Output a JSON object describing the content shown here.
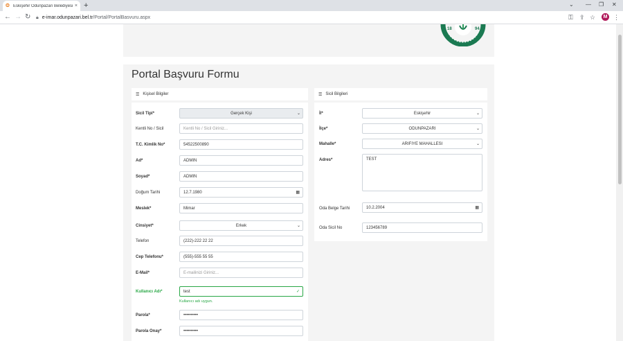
{
  "browser": {
    "tab_title": "Eskişehir Odunpazarı Belediyesi :: ...",
    "tab_close": "×",
    "new_tab": "+",
    "url_host": "e-imar.odunpazari.bel.tr",
    "url_path": "/Portal/PortalBasvuru.aspx",
    "avatar_letter": "M",
    "win_min": "—",
    "win_max": "❐",
    "win_close": "✕",
    "collapse": "⌄"
  },
  "page": {
    "title": "Portal Başvuru Formu"
  },
  "left_panel": {
    "heading": "Kişisel Bilgiler",
    "fields": [
      {
        "label": "Sicil Tipi*",
        "value": "Gerçek Kişi"
      },
      {
        "label": "Kentli No / Sicil",
        "placeholder": "Kentli No / Sicil Giriniz..."
      },
      {
        "label": "T.C. Kimlik No*",
        "value": "54522500890"
      },
      {
        "label": "Ad*",
        "value": "ADMIN"
      },
      {
        "label": "Soyad*",
        "value": "ADMIN"
      },
      {
        "label": "Doğum Tarihi",
        "value": "12.7.1980"
      },
      {
        "label": "Meslek*",
        "value": "Mimar"
      },
      {
        "label": "Cinsiyet*",
        "value": "Erkek"
      },
      {
        "label": "Telefon",
        "value": "(222)-222 22 22"
      },
      {
        "label": "Cep Telefonu*",
        "value": "(555)-555 55 55"
      },
      {
        "label": "E-Mail*",
        "placeholder": "E-mailinizi Giriniz..."
      },
      {
        "label": "Kullanıcı Adı*",
        "value": "test",
        "hint": "Kullanıcı adı uygun."
      },
      {
        "label": "Parola*",
        "value": "••••••••••"
      },
      {
        "label": "Parola Onay*",
        "value": "••••••••••"
      }
    ]
  },
  "right_panel": {
    "heading": "Sicil Bilgileri",
    "fields": [
      {
        "label": "İl*",
        "value": "Eskişehir"
      },
      {
        "label": "İlçe*",
        "value": "ODUNPAZARI"
      },
      {
        "label": "Mahalle*",
        "value": "ARIFIYE MAHALLESI"
      },
      {
        "label": "Adres*",
        "value": "TEST"
      },
      {
        "label": "Oda Belge Tarihi",
        "value": "10.2.2004"
      },
      {
        "label": "Oda Sicil No",
        "value": "123456789"
      }
    ]
  },
  "colors": {
    "valid": "#28a745",
    "panel_bg": "#f4f4f4"
  },
  "icons": {
    "calendar": "calendar-icon",
    "list": "list-icon",
    "select_caret": "chevron-down-icon"
  }
}
